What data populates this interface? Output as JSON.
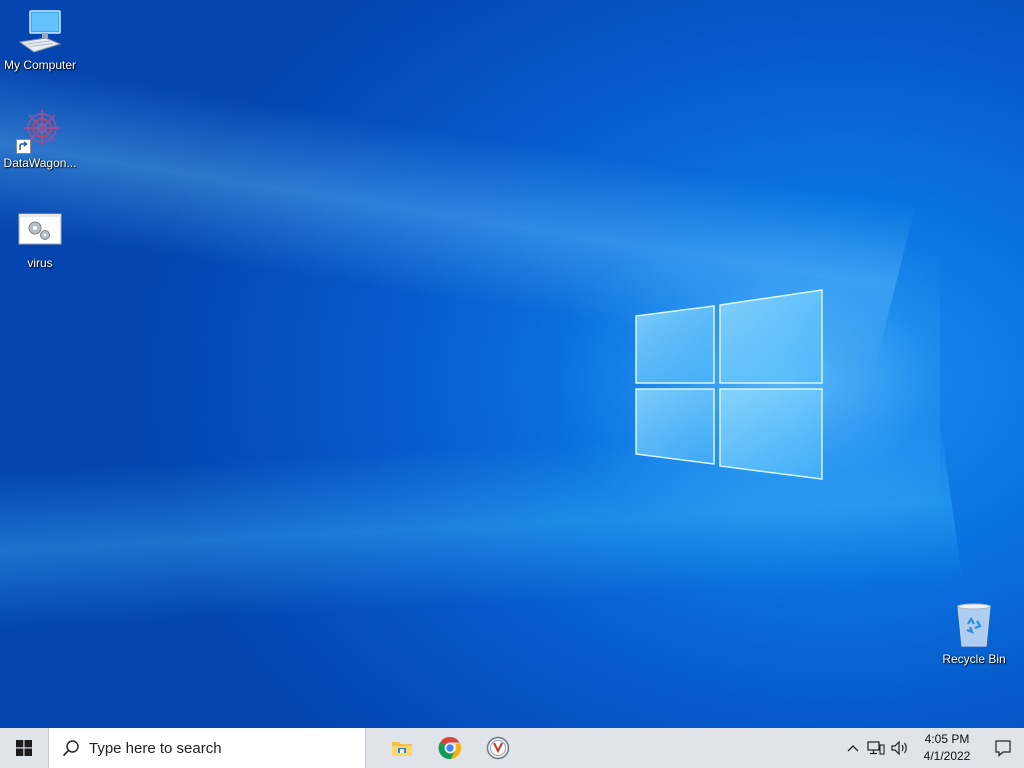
{
  "desktop": {
    "icons": [
      {
        "label": "My Computer",
        "icon": "computer-icon"
      },
      {
        "label": "DataWagon...",
        "icon": "datawagon-app-icon"
      },
      {
        "label": "virus",
        "icon": "settings-gears-icon"
      },
      {
        "label": "Recycle Bin",
        "icon": "recycle-bin-icon"
      }
    ]
  },
  "taskbar": {
    "start_icon": "windows-start-icon",
    "search_placeholder": "Type here to search",
    "pinned": [
      {
        "name": "File Explorer",
        "icon": "file-explorer-icon"
      },
      {
        "name": "Google Chrome",
        "icon": "chrome-icon"
      },
      {
        "name": "Terminal app",
        "icon": "app-icon"
      }
    ],
    "tray": {
      "time": "4:05 PM",
      "date": "4/1/2022"
    }
  },
  "colors": {
    "desktop_blue": "#0a73e0",
    "taskbar_bg": "#dfe3ea"
  }
}
